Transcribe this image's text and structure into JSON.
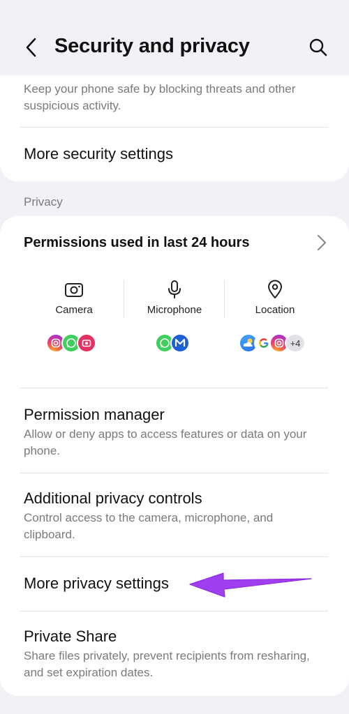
{
  "header": {
    "title": "Security and privacy",
    "back_icon": "chevron-left-icon",
    "search_icon": "search-icon"
  },
  "top_card": {
    "description": "Keep your phone safe by blocking threats and other suspicious activity.",
    "more_security_label": "More security settings"
  },
  "privacy": {
    "section_label": "Privacy",
    "permissions_title": "Permissions used in last 24 hours",
    "permission_columns": [
      {
        "label": "Camera",
        "icon": "camera-icon",
        "apps": [
          "instagram",
          "whatsapp",
          "camera-app"
        ]
      },
      {
        "label": "Microphone",
        "icon": "microphone-icon",
        "apps": [
          "whatsapp",
          "m-app"
        ]
      },
      {
        "label": "Location",
        "icon": "location-pin-icon",
        "apps": [
          "weather",
          "google",
          "instagram"
        ],
        "more": "+4"
      }
    ],
    "items": [
      {
        "title": "Permission manager",
        "description": "Allow or deny apps to access features or data on your phone."
      },
      {
        "title": "Additional privacy controls",
        "description": "Control access to the camera, microphone, and clipboard."
      },
      {
        "title": "More privacy settings"
      },
      {
        "title": "Private Share",
        "description": "Share files privately, prevent recipients from resharing, and set expiration dates."
      }
    ]
  },
  "colors": {
    "background": "#f2f1f6",
    "card": "#ffffff",
    "secondary_text": "#7a7a7a",
    "annotation_arrow": "#a03ff0"
  }
}
